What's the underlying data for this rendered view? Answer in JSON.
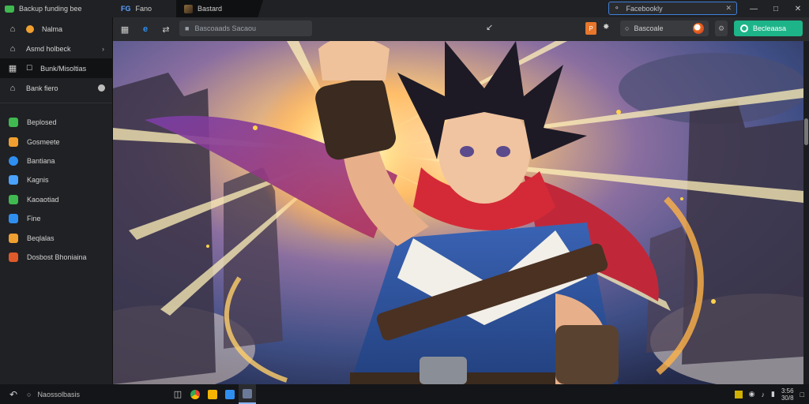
{
  "titlebar": {
    "app_title": "Backup funding bee",
    "tabs": [
      {
        "label": "Fano",
        "icon": "fg-icon"
      },
      {
        "label": "Bastard",
        "icon": "game-thumb-icon"
      }
    ],
    "search_value": "Facebookly"
  },
  "sidebar": {
    "items": [
      {
        "label": "Nalma"
      },
      {
        "label": "Asmd holbeck"
      },
      {
        "label": "Bunk/Misoltias"
      },
      {
        "label": "Bank fiero"
      }
    ],
    "games": [
      {
        "label": "Beplosed",
        "color": "#3fb950"
      },
      {
        "label": "Gosmeete",
        "color": "#f0a030"
      },
      {
        "label": "Bantiana",
        "color": "#2f8ff0"
      },
      {
        "label": "Kagnis",
        "color": "#4aa3ff"
      },
      {
        "label": "Kaoaotiad",
        "color": "#3fb950"
      },
      {
        "label": "Fine",
        "color": "#2f8ff0"
      },
      {
        "label": "Beqlalas",
        "color": "#f0a030"
      },
      {
        "label": "Dosbost Bhoniaina",
        "color": "#e05a2a"
      }
    ]
  },
  "toolbar": {
    "address_placeholder": "Bascoaads Sacaou",
    "account_label": "Bascoale",
    "start_label": "Becleaasa",
    "orange_badge": "P"
  },
  "taskbar": {
    "search_label": "Naossolbasis",
    "clock_line1": "3:56",
    "clock_line2": "30/8"
  },
  "colors": {
    "accent_green": "#1db489",
    "search_border": "#3f7fd9"
  }
}
